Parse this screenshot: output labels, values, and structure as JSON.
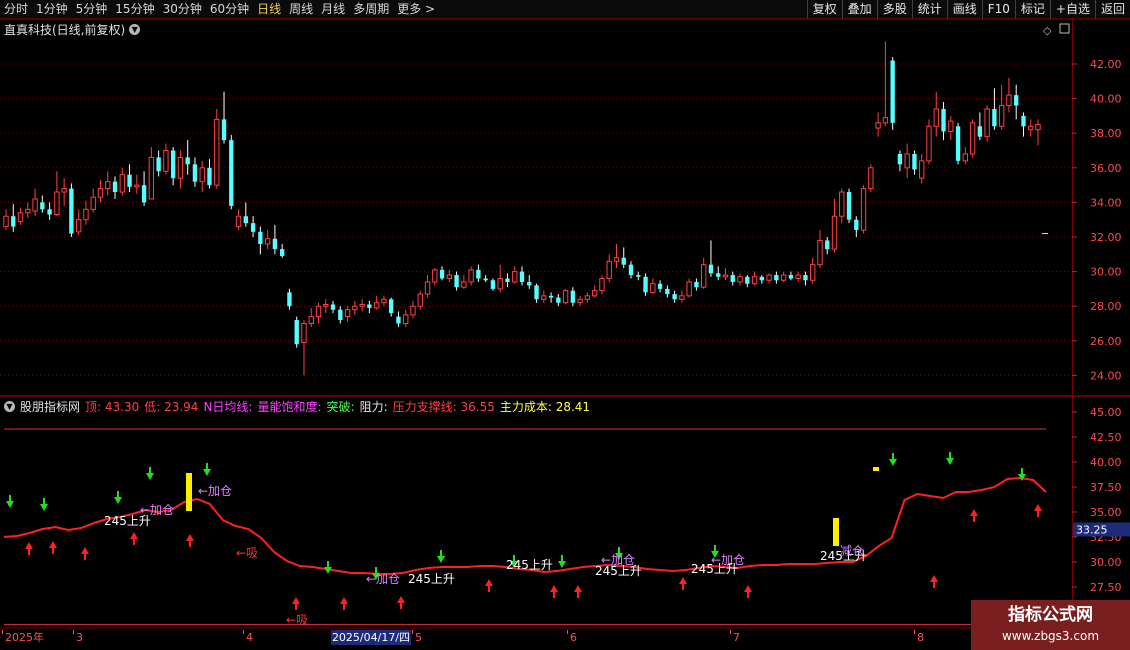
{
  "toolbar": {
    "periods": [
      "分时",
      "1分钟",
      "5分钟",
      "15分钟",
      "30分钟",
      "60分钟",
      "日线",
      "周线",
      "月线",
      "多周期",
      "更多 >"
    ],
    "active_period": "日线",
    "right_tools": [
      "复权",
      "叠加",
      "多股",
      "统计",
      "画线",
      "F10",
      "标记",
      "+自选",
      "返回"
    ]
  },
  "price_panel": {
    "title": "直真科技(日线,前复权)",
    "y_ticks": [
      "42.00",
      "40.00",
      "38.00",
      "36.00",
      "34.00",
      "32.00",
      "30.00",
      "28.00",
      "26.00",
      "24.00"
    ]
  },
  "indicator_panel": {
    "name": "股朋指标网",
    "labels": [
      {
        "text": "顶: 43.30",
        "color": "red"
      },
      {
        "text": "低: 23.94",
        "color": "red"
      },
      {
        "text": "N日均线:",
        "color": "mag"
      },
      {
        "text": "量能饱和度:",
        "color": "mag"
      },
      {
        "text": "突破:",
        "color": "green"
      },
      {
        "text": "阻力:",
        "color": "white"
      },
      {
        "text": "压力支撑线: 36.55",
        "color": "red"
      },
      {
        "text": "主力成本: 28.41",
        "color": "yellow"
      }
    ],
    "y_ticks": [
      "45.00",
      "42.50",
      "40.00",
      "37.50",
      "35.00",
      "32.50",
      "30.00",
      "27.50",
      "25.00"
    ],
    "current_value": "33.25",
    "annotations": {
      "rise": "245上升",
      "add": "←加仓",
      "absorb": "←吸",
      "cut": "减仓"
    }
  },
  "date_axis": {
    "labels": [
      "2025年",
      "3",
      "4",
      "5",
      "6",
      "7",
      "8"
    ],
    "cursor": "2025/04/17/四"
  },
  "watermark": {
    "title": "指标公式网",
    "url": "www.zbgs3.com"
  },
  "colors": {
    "up": "#ff4040",
    "down": "#54ffff",
    "grid": "#7a0000",
    "line": "#ff2020",
    "accent": "#f0d060",
    "cursor": "#1d2b7a"
  },
  "chart_data": {
    "type": "candlestick",
    "date_range": [
      "2025-01",
      "2025-08"
    ],
    "candles": [
      {
        "o": 32.6,
        "c": 33.2,
        "h": 33.6,
        "l": 32.4
      },
      {
        "o": 33.2,
        "c": 32.6,
        "h": 33.9,
        "l": 32.3
      },
      {
        "o": 32.9,
        "c": 33.4,
        "h": 33.7,
        "l": 32.7
      },
      {
        "o": 33.4,
        "c": 33.6,
        "h": 34.0,
        "l": 33.1
      },
      {
        "o": 33.5,
        "c": 34.2,
        "h": 34.8,
        "l": 33.2
      },
      {
        "o": 34.0,
        "c": 33.6,
        "h": 34.4,
        "l": 33.4
      },
      {
        "o": 33.6,
        "c": 33.3,
        "h": 34.0,
        "l": 33.0
      },
      {
        "o": 33.3,
        "c": 34.6,
        "h": 35.8,
        "l": 33.2
      },
      {
        "o": 34.6,
        "c": 34.8,
        "h": 35.4,
        "l": 33.8
      },
      {
        "o": 34.8,
        "c": 32.2,
        "h": 35.1,
        "l": 32.0
      },
      {
        "o": 32.3,
        "c": 33.0,
        "h": 33.6,
        "l": 32.1
      },
      {
        "o": 33.0,
        "c": 33.6,
        "h": 34.1,
        "l": 32.7
      },
      {
        "o": 33.6,
        "c": 34.3,
        "h": 34.8,
        "l": 33.4
      },
      {
        "o": 34.3,
        "c": 34.8,
        "h": 35.3,
        "l": 34.0
      },
      {
        "o": 34.8,
        "c": 35.2,
        "h": 35.8,
        "l": 34.4
      },
      {
        "o": 35.2,
        "c": 34.6,
        "h": 35.5,
        "l": 34.2
      },
      {
        "o": 34.6,
        "c": 35.6,
        "h": 36.0,
        "l": 34.4
      },
      {
        "o": 35.6,
        "c": 34.9,
        "h": 36.2,
        "l": 34.6
      },
      {
        "o": 34.9,
        "c": 35.0,
        "h": 35.6,
        "l": 34.5
      },
      {
        "o": 35.0,
        "c": 34.0,
        "h": 35.8,
        "l": 33.8
      },
      {
        "o": 34.2,
        "c": 36.6,
        "h": 37.2,
        "l": 34.2
      },
      {
        "o": 36.6,
        "c": 35.8,
        "h": 37.0,
        "l": 35.5
      },
      {
        "o": 35.8,
        "c": 37.0,
        "h": 37.4,
        "l": 35.6
      },
      {
        "o": 37.0,
        "c": 35.4,
        "h": 37.2,
        "l": 35.0
      },
      {
        "o": 35.4,
        "c": 36.6,
        "h": 37.0,
        "l": 34.8
      },
      {
        "o": 36.6,
        "c": 36.2,
        "h": 37.6,
        "l": 35.6
      },
      {
        "o": 36.2,
        "c": 35.2,
        "h": 36.6,
        "l": 34.9
      },
      {
        "o": 35.2,
        "c": 36.0,
        "h": 36.4,
        "l": 34.6
      },
      {
        "o": 36.0,
        "c": 35.0,
        "h": 36.5,
        "l": 34.8
      },
      {
        "o": 35.0,
        "c": 38.8,
        "h": 39.4,
        "l": 34.8
      },
      {
        "o": 38.8,
        "c": 37.6,
        "h": 40.4,
        "l": 37.4
      },
      {
        "o": 37.6,
        "c": 33.8,
        "h": 37.9,
        "l": 33.6
      },
      {
        "o": 32.6,
        "c": 33.2,
        "h": 33.6,
        "l": 32.4
      },
      {
        "o": 33.2,
        "c": 32.8,
        "h": 34.0,
        "l": 32.6
      },
      {
        "o": 32.8,
        "c": 32.3,
        "h": 33.2,
        "l": 32.0
      },
      {
        "o": 32.3,
        "c": 31.6,
        "h": 32.6,
        "l": 31.0
      },
      {
        "o": 31.6,
        "c": 31.9,
        "h": 32.4,
        "l": 31.3
      },
      {
        "o": 31.9,
        "c": 31.3,
        "h": 32.7,
        "l": 31.0
      },
      {
        "o": 31.3,
        "c": 30.9,
        "h": 31.6,
        "l": 30.8
      },
      {
        "o": 28.8,
        "c": 28.0,
        "h": 29.0,
        "l": 27.8
      },
      {
        "o": 27.2,
        "c": 25.8,
        "h": 27.4,
        "l": 25.6
      },
      {
        "o": 25.9,
        "c": 27.0,
        "h": 27.2,
        "l": 24.0
      },
      {
        "o": 27.0,
        "c": 27.4,
        "h": 27.9,
        "l": 26.8
      },
      {
        "o": 27.4,
        "c": 28.0,
        "h": 28.2,
        "l": 27.0
      },
      {
        "o": 28.0,
        "c": 28.1,
        "h": 28.4,
        "l": 27.6
      },
      {
        "o": 28.1,
        "c": 27.8,
        "h": 28.3,
        "l": 27.6
      },
      {
        "o": 27.8,
        "c": 27.2,
        "h": 28.0,
        "l": 27.0
      },
      {
        "o": 27.4,
        "c": 27.8,
        "h": 28.0,
        "l": 27.1
      },
      {
        "o": 27.8,
        "c": 28.0,
        "h": 28.3,
        "l": 27.5
      },
      {
        "o": 28.0,
        "c": 28.1,
        "h": 28.4,
        "l": 27.7
      },
      {
        "o": 28.1,
        "c": 27.9,
        "h": 28.3,
        "l": 27.6
      },
      {
        "o": 27.9,
        "c": 28.2,
        "h": 28.6,
        "l": 27.8
      },
      {
        "o": 28.2,
        "c": 28.4,
        "h": 28.6,
        "l": 28.0
      },
      {
        "o": 28.4,
        "c": 27.6,
        "h": 28.5,
        "l": 27.4
      },
      {
        "o": 27.4,
        "c": 27.0,
        "h": 27.7,
        "l": 26.8
      },
      {
        "o": 27.0,
        "c": 27.5,
        "h": 27.8,
        "l": 26.8
      },
      {
        "o": 27.5,
        "c": 28.0,
        "h": 28.3,
        "l": 27.3
      },
      {
        "o": 28.0,
        "c": 28.7,
        "h": 28.9,
        "l": 27.8
      },
      {
        "o": 28.7,
        "c": 29.4,
        "h": 29.8,
        "l": 28.5
      },
      {
        "o": 29.4,
        "c": 30.1,
        "h": 30.2,
        "l": 29.2
      },
      {
        "o": 30.1,
        "c": 29.6,
        "h": 30.3,
        "l": 29.5
      },
      {
        "o": 29.6,
        "c": 29.8,
        "h": 30.1,
        "l": 29.4
      },
      {
        "o": 29.8,
        "c": 29.1,
        "h": 30.0,
        "l": 28.9
      },
      {
        "o": 29.1,
        "c": 29.4,
        "h": 29.8,
        "l": 29.0
      },
      {
        "o": 29.4,
        "c": 30.1,
        "h": 30.3,
        "l": 29.2
      },
      {
        "o": 30.1,
        "c": 29.6,
        "h": 30.4,
        "l": 29.4
      },
      {
        "o": 29.6,
        "c": 29.5,
        "h": 29.8,
        "l": 29.4
      },
      {
        "o": 29.5,
        "c": 29.0,
        "h": 29.6,
        "l": 28.9
      },
      {
        "o": 29.0,
        "c": 29.6,
        "h": 30.4,
        "l": 28.8
      },
      {
        "o": 29.6,
        "c": 29.4,
        "h": 29.9,
        "l": 29.1
      },
      {
        "o": 29.4,
        "c": 30.0,
        "h": 30.3,
        "l": 29.3
      },
      {
        "o": 30.0,
        "c": 29.4,
        "h": 30.3,
        "l": 29.2
      },
      {
        "o": 29.4,
        "c": 29.2,
        "h": 29.8,
        "l": 29.0
      },
      {
        "o": 29.2,
        "c": 28.4,
        "h": 29.3,
        "l": 28.2
      },
      {
        "o": 28.4,
        "c": 28.6,
        "h": 28.9,
        "l": 28.2
      },
      {
        "o": 28.6,
        "c": 28.5,
        "h": 28.8,
        "l": 28.2
      },
      {
        "o": 28.5,
        "c": 28.2,
        "h": 28.7,
        "l": 28.0
      },
      {
        "o": 28.2,
        "c": 28.9,
        "h": 29.0,
        "l": 28.1
      },
      {
        "o": 28.9,
        "c": 28.2,
        "h": 29.1,
        "l": 28.0
      },
      {
        "o": 28.2,
        "c": 28.4,
        "h": 28.6,
        "l": 28.0
      },
      {
        "o": 28.4,
        "c": 28.6,
        "h": 28.8,
        "l": 28.2
      },
      {
        "o": 28.6,
        "c": 28.9,
        "h": 29.2,
        "l": 28.5
      },
      {
        "o": 28.9,
        "c": 29.6,
        "h": 29.8,
        "l": 28.7
      },
      {
        "o": 29.6,
        "c": 30.6,
        "h": 31.0,
        "l": 29.4
      },
      {
        "o": 30.6,
        "c": 30.8,
        "h": 31.6,
        "l": 30.2
      },
      {
        "o": 30.8,
        "c": 30.4,
        "h": 31.4,
        "l": 30.2
      },
      {
        "o": 30.4,
        "c": 29.8,
        "h": 30.6,
        "l": 29.6
      },
      {
        "o": 29.8,
        "c": 29.7,
        "h": 30.0,
        "l": 29.5
      },
      {
        "o": 29.7,
        "c": 28.8,
        "h": 29.9,
        "l": 28.6
      },
      {
        "o": 28.8,
        "c": 29.3,
        "h": 29.6,
        "l": 28.7
      },
      {
        "o": 29.3,
        "c": 29.0,
        "h": 29.5,
        "l": 28.8
      },
      {
        "o": 29.0,
        "c": 28.7,
        "h": 29.2,
        "l": 28.5
      },
      {
        "o": 28.7,
        "c": 28.4,
        "h": 28.9,
        "l": 28.2
      },
      {
        "o": 28.4,
        "c": 28.6,
        "h": 28.9,
        "l": 28.2
      },
      {
        "o": 28.6,
        "c": 29.4,
        "h": 29.6,
        "l": 28.5
      },
      {
        "o": 29.4,
        "c": 29.1,
        "h": 29.6,
        "l": 28.9
      },
      {
        "o": 29.1,
        "c": 30.4,
        "h": 30.8,
        "l": 29.0
      },
      {
        "o": 30.4,
        "c": 29.9,
        "h": 31.8,
        "l": 29.7
      },
      {
        "o": 29.9,
        "c": 29.7,
        "h": 30.3,
        "l": 29.5
      },
      {
        "o": 29.7,
        "c": 29.8,
        "h": 30.2,
        "l": 29.5
      },
      {
        "o": 29.8,
        "c": 29.4,
        "h": 30.0,
        "l": 29.2
      },
      {
        "o": 29.4,
        "c": 29.7,
        "h": 29.9,
        "l": 29.2
      },
      {
        "o": 29.7,
        "c": 29.3,
        "h": 29.8,
        "l": 29.1
      },
      {
        "o": 29.3,
        "c": 29.7,
        "h": 30.0,
        "l": 29.2
      },
      {
        "o": 29.7,
        "c": 29.5,
        "h": 29.8,
        "l": 29.3
      },
      {
        "o": 29.5,
        "c": 29.8,
        "h": 29.9,
        "l": 29.3
      },
      {
        "o": 29.8,
        "c": 29.5,
        "h": 30.0,
        "l": 29.3
      },
      {
        "o": 29.5,
        "c": 29.8,
        "h": 30.0,
        "l": 29.4
      },
      {
        "o": 29.8,
        "c": 29.6,
        "h": 30.0,
        "l": 29.5
      },
      {
        "o": 29.6,
        "c": 29.8,
        "h": 30.0,
        "l": 29.4
      },
      {
        "o": 29.8,
        "c": 29.5,
        "h": 30.0,
        "l": 29.2
      },
      {
        "o": 29.5,
        "c": 30.4,
        "h": 30.8,
        "l": 29.3
      },
      {
        "o": 30.4,
        "c": 31.8,
        "h": 32.4,
        "l": 30.2
      },
      {
        "o": 31.8,
        "c": 31.3,
        "h": 32.0,
        "l": 31.0
      },
      {
        "o": 31.3,
        "c": 33.2,
        "h": 34.2,
        "l": 31.1
      },
      {
        "o": 33.2,
        "c": 34.6,
        "h": 34.8,
        "l": 32.8
      },
      {
        "o": 34.6,
        "c": 33.0,
        "h": 34.8,
        "l": 32.8
      },
      {
        "o": 33.0,
        "c": 32.4,
        "h": 33.2,
        "l": 32.0
      },
      {
        "o": 32.4,
        "c": 34.8,
        "h": 35.0,
        "l": 32.2
      },
      {
        "o": 34.8,
        "c": 36.0,
        "h": 36.2,
        "l": 34.6
      },
      {
        "o": 38.3,
        "c": 38.6,
        "h": 39.2,
        "l": 37.8
      },
      {
        "o": 38.6,
        "c": 38.9,
        "h": 43.3,
        "l": 38.4
      },
      {
        "o": 42.2,
        "c": 38.6,
        "h": 42.4,
        "l": 38.2
      },
      {
        "o": 36.8,
        "c": 36.2,
        "h": 37.0,
        "l": 35.8
      },
      {
        "o": 36.0,
        "c": 36.8,
        "h": 37.4,
        "l": 35.4
      },
      {
        "o": 36.8,
        "c": 35.9,
        "h": 37.0,
        "l": 35.6
      },
      {
        "o": 35.4,
        "c": 36.4,
        "h": 36.8,
        "l": 35.1
      },
      {
        "o": 36.4,
        "c": 38.4,
        "h": 38.8,
        "l": 36.2
      },
      {
        "o": 38.4,
        "c": 39.4,
        "h": 40.4,
        "l": 37.8
      },
      {
        "o": 39.4,
        "c": 38.1,
        "h": 39.8,
        "l": 37.6
      },
      {
        "o": 38.1,
        "c": 38.7,
        "h": 39.0,
        "l": 37.6
      },
      {
        "o": 38.4,
        "c": 36.4,
        "h": 38.6,
        "l": 36.2
      },
      {
        "o": 36.4,
        "c": 36.8,
        "h": 37.2,
        "l": 36.2
      },
      {
        "o": 36.8,
        "c": 38.6,
        "h": 38.8,
        "l": 36.6
      },
      {
        "o": 38.4,
        "c": 37.8,
        "h": 39.2,
        "l": 37.6
      },
      {
        "o": 37.8,
        "c": 39.4,
        "h": 39.6,
        "l": 37.5
      },
      {
        "o": 39.4,
        "c": 38.4,
        "h": 40.6,
        "l": 38.2
      },
      {
        "o": 38.4,
        "c": 39.6,
        "h": 40.8,
        "l": 38.2
      },
      {
        "o": 39.6,
        "c": 40.2,
        "h": 41.2,
        "l": 39.2
      },
      {
        "o": 40.2,
        "c": 39.6,
        "h": 40.8,
        "l": 38.8
      },
      {
        "o": 39.0,
        "c": 38.4,
        "h": 39.2,
        "l": 37.8
      },
      {
        "o": 38.2,
        "c": 38.4,
        "h": 38.8,
        "l": 37.8
      },
      {
        "o": 38.2,
        "c": 38.5,
        "h": 38.8,
        "l": 37.3
      }
    ],
    "indicator": {
      "pressure_line": [
        32.5,
        32.6,
        32.9,
        33.3,
        33.5,
        33.2,
        33.4,
        33.9,
        34.3,
        34.5,
        34.8,
        35.2,
        35.0,
        35.2,
        36.0,
        36.3,
        35.8,
        34.2,
        33.6,
        33.3,
        32.4,
        31.0,
        30.1,
        29.6,
        29.5,
        29.3,
        29.1,
        28.9,
        28.9,
        28.8,
        28.8,
        28.9,
        29.2,
        29.4,
        29.5,
        29.5,
        29.5,
        29.6,
        29.6,
        29.5,
        29.3,
        29.2,
        29.0,
        29.1,
        29.3,
        29.5,
        29.6,
        29.7,
        29.6,
        29.5,
        29.3,
        29.2,
        29.1,
        29.2,
        29.4,
        29.6,
        29.5,
        29.4,
        29.6,
        29.7,
        29.7,
        29.8,
        29.8,
        29.8,
        29.9,
        30.0,
        30.0,
        30.6,
        31.6,
        32.4,
        36.2,
        36.8,
        36.6,
        36.4,
        37.0,
        37.0,
        37.2,
        37.5,
        38.3,
        38.4,
        38.2,
        37.0
      ],
      "top_line": 43.3,
      "bottom_line": 23.94,
      "down_arrows_y": [
        35.6,
        35.3,
        38.4,
        36.0,
        38.8,
        39.8,
        29.0,
        28.4,
        30.1,
        29.6,
        29.6,
        30.4,
        30.6,
        39.9,
        38.3
      ],
      "up_arrows_y": [
        31.5,
        31.6,
        31.0,
        32.5,
        32.3,
        26.0,
        26.0,
        26.1,
        27.8,
        27.2,
        27.2,
        28.0,
        27.2,
        28.2,
        34.8,
        35.3,
        36.2
      ]
    }
  }
}
